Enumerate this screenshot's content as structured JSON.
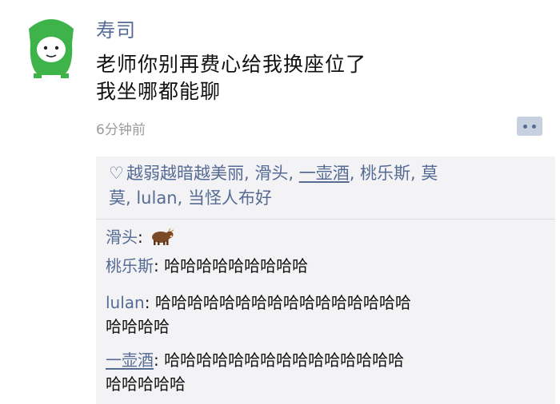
{
  "post": {
    "author": "寿司",
    "lines": [
      "老师你别再费心给我换座位了",
      "我坐哪都能聊"
    ],
    "timestamp": "6分钟前"
  },
  "likes": {
    "line1_before": "越弱越暗越美丽, 滑头, ",
    "line1_underlined": "一壶酒",
    "line1_after": ", 桃乐斯, 莫",
    "line2": "莫, lulan, 当怪人布好"
  },
  "comments": [
    {
      "name": "滑头",
      "sep": ": ",
      "text": ""
    },
    {
      "name": "桃乐斯",
      "sep": ": ",
      "text": "哈哈哈哈哈哈哈哈哈"
    },
    {
      "name": "lulan",
      "sep": ": ",
      "text": "哈哈哈哈哈哈哈哈哈哈哈哈哈哈哈哈",
      "text2": "哈哈哈哈"
    },
    {
      "name": "一壶酒",
      "sep": ": ",
      "text": "哈哈哈哈哈哈哈哈哈哈哈哈哈哈哈",
      "text2": "哈哈哈哈哈"
    }
  ],
  "icons": {
    "heart": "♡",
    "cow_emoji": "cow-icon"
  },
  "colors": {
    "name_blue": "#566b94",
    "panel_bg": "#f3f3f5",
    "avatar_green": "#3db34a"
  }
}
